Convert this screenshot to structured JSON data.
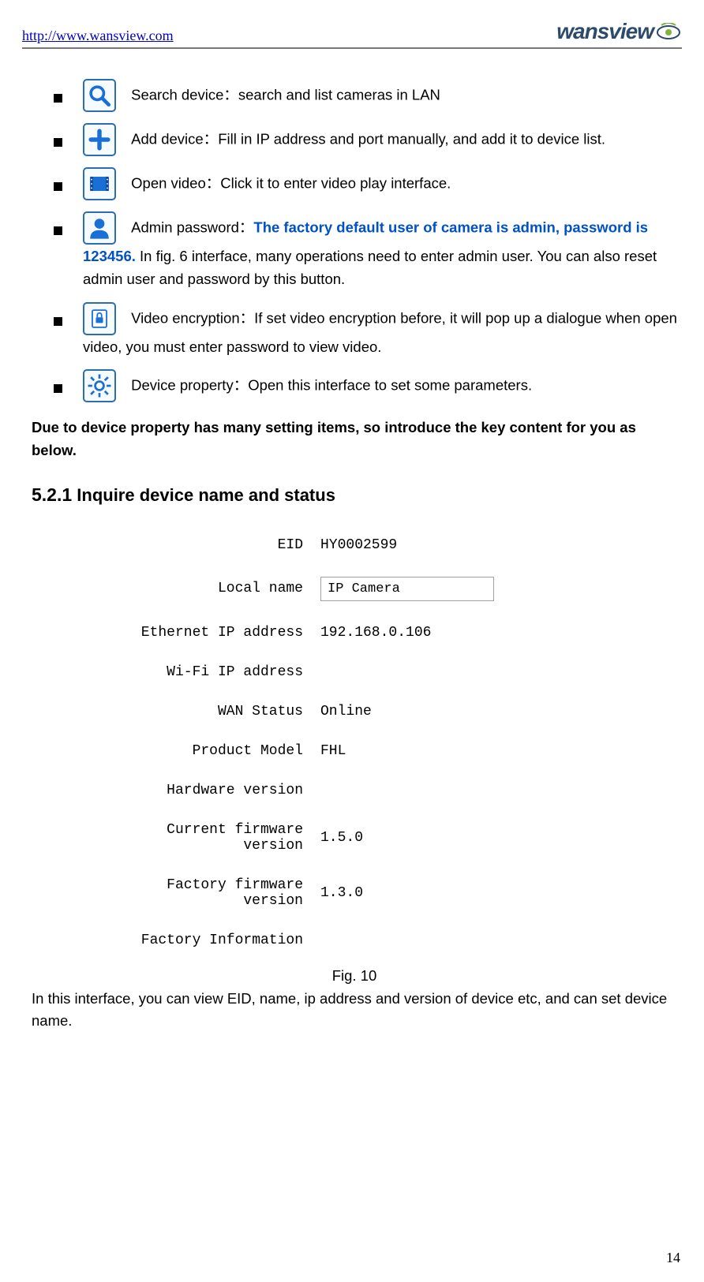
{
  "header": {
    "url": "http://www.wansview.com",
    "logo_text": "wansview"
  },
  "bullets": [
    {
      "icon": "search-icon",
      "label": "Search device：",
      "text": "search and list cameras in LAN"
    },
    {
      "icon": "add-icon",
      "label": "Add device：",
      "text": "Fill in IP address and port manually, and add it to device list."
    },
    {
      "icon": "video-icon",
      "label": "Open video：",
      "text": "Click it to enter video play interface."
    },
    {
      "icon": "admin-icon",
      "label": "Admin password：",
      "blue": "The factory default user of camera is admin, password is 123456.",
      "text2": "  In fig. 6 interface, many operations need to enter admin user. You can also reset admin user and password by this button."
    },
    {
      "icon": "encryption-icon",
      "label": "Video encryption：",
      "text": "If set video encryption before, it will pop up a dialogue when open video, you must enter password to view video."
    },
    {
      "icon": "property-icon",
      "label": "Device property：",
      "text": "Open this interface to set some parameters."
    }
  ],
  "section_note": "Due to device property has many setting items, so introduce the key content for you as below.",
  "section_heading_num": "5.2.1",
  "section_heading_text": " Inquire device name and status",
  "props": {
    "eid_label": "EID",
    "eid_value": "HY0002599",
    "localname_label": "Local name",
    "localname_value": "IP Camera",
    "ethip_label": "Ethernet IP address",
    "ethip_value": "192.168.0.106",
    "wifiip_label": "Wi-Fi IP address",
    "wifiip_value": "",
    "wan_label": "WAN Status",
    "wan_value": "Online",
    "model_label": "Product Model",
    "model_value": "FHL",
    "hwver_label": "Hardware version",
    "hwver_value": "",
    "curfw_label": "Current firmware version",
    "curfw_value": "1.5.0",
    "facfw_label": "Factory firmware version",
    "facfw_value": "1.3.0",
    "facinfo_label": "Factory Information",
    "facinfo_value": ""
  },
  "fig_caption": "Fig. 10",
  "body_para": "In this interface, you can view EID, name, ip address and version of device etc, and can set device name.",
  "page_num": "14"
}
